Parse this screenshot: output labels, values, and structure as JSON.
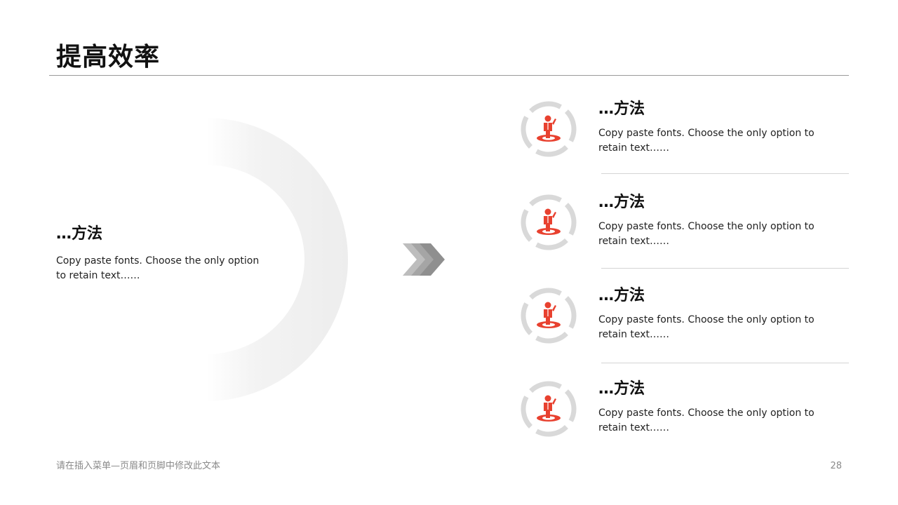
{
  "slide": {
    "title": "提高效率",
    "left": {
      "heading": "…方法",
      "description": "Copy paste fonts. Choose the only option to retain text……"
    },
    "items": [
      {
        "heading": "…方法",
        "description": "Copy paste fonts. Choose the only option to retain text……",
        "icon": "person-on-target-icon"
      },
      {
        "heading": "…方法",
        "description": "Copy paste fonts. Choose the only option to retain text……",
        "icon": "person-on-target-icon"
      },
      {
        "heading": "…方法",
        "description": "Copy paste fonts. Choose the only option to retain text……",
        "icon": "person-on-target-icon"
      },
      {
        "heading": "…方法",
        "description": "Copy paste fonts. Choose the only option to retain text……",
        "icon": "person-on-target-icon"
      }
    ]
  },
  "footer": {
    "text": "请在插入菜单—页眉和页脚中修改此文本",
    "page_number": "28"
  },
  "colors": {
    "accent": "#e8412f",
    "ring": "#d9d9d9",
    "arc": "#f2f2f2",
    "chevron": "#9a9a9a"
  }
}
